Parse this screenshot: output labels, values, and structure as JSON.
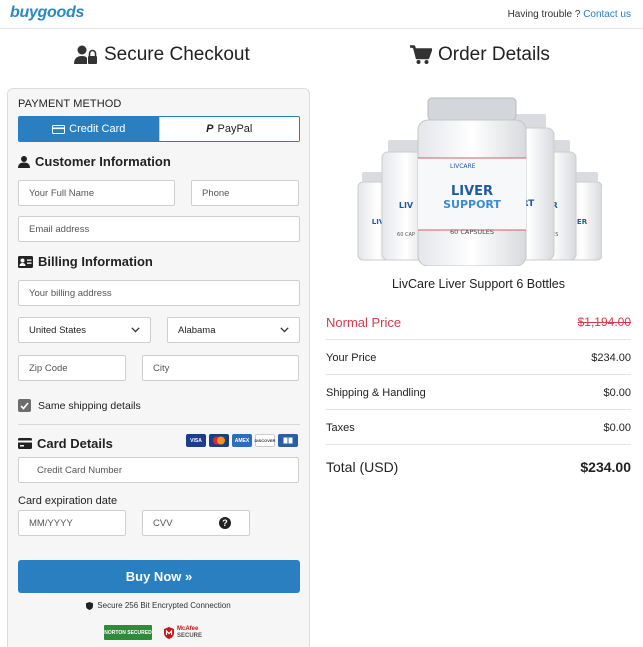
{
  "header": {
    "logo": "buygoods",
    "trouble_text": "Having trouble ?",
    "contact_link": "Contact us"
  },
  "checkout": {
    "title": "Secure Checkout",
    "payment_method_label": "PAYMENT METHOD",
    "tabs": [
      {
        "label": "Credit Card",
        "active": true
      },
      {
        "label": "PayPal",
        "active": false
      }
    ],
    "customer_info_title": "Customer Information",
    "full_name_placeholder": "Your Full Name",
    "phone_placeholder": "Phone",
    "email_placeholder": "Email address",
    "billing_info_title": "Billing Information",
    "billing_address_placeholder": "Your billing address",
    "country_value": "United States",
    "state_value": "Alabama",
    "zip_placeholder": "Zip Code",
    "city_placeholder": "City",
    "same_shipping_label": "Same shipping details",
    "same_shipping_checked": true,
    "card_details_title": "Card Details",
    "card_brands": [
      "VISA",
      "MC",
      "AMEX",
      "DISCOVER",
      "DINERS"
    ],
    "card_number_placeholder": "Credit Card Number",
    "expiration_label": "Card expiration date",
    "expiry_placeholder": "MM/YYYY",
    "cvv_placeholder": "CVV",
    "buy_button": "Buy Now »",
    "secure_note": "Secure 256 Bit Encrypted Connection",
    "badge_norton": "NORTON SECURED",
    "badge_mcafee_line1": "McAfee",
    "badge_mcafee_line2": "SECURE"
  },
  "order": {
    "title": "Order Details",
    "product_brand": "LIVCARE",
    "product_line1": "LIVER",
    "product_line2": "SUPPORT",
    "product_capsules": "60 CAPSULES",
    "product_name": "LivCare Liver Support 6 Bottles",
    "normal_price_label": "Normal Price",
    "normal_price": "$1,194.00",
    "your_price_label": "Your Price",
    "your_price": "$234.00",
    "shipping_label": "Shipping & Handling",
    "shipping": "$0.00",
    "taxes_label": "Taxes",
    "taxes": "$0.00",
    "total_label": "Total (USD)",
    "total": "$234.00"
  },
  "colors": {
    "accent": "#2a7fc0",
    "normal_price": "#d33a4e"
  }
}
